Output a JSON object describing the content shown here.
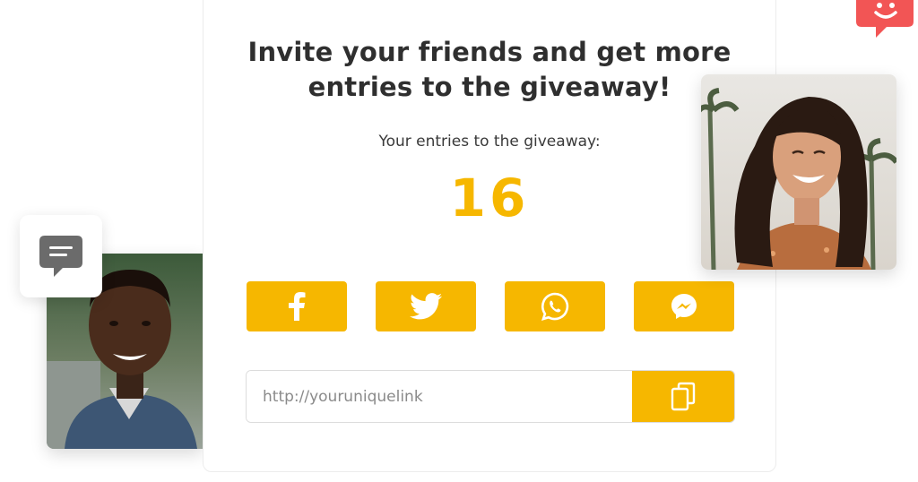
{
  "card": {
    "title_line1": "Invite your friends and get more",
    "title_line2": "entries to the giveaway!",
    "entries_label": "Your entries to the giveaway:",
    "entries_count": "16"
  },
  "share": {
    "buttons": [
      {
        "icon": "facebook-icon"
      },
      {
        "icon": "twitter-icon"
      },
      {
        "icon": "whatsapp-icon"
      },
      {
        "icon": "messenger-icon"
      }
    ]
  },
  "link": {
    "value": "http://youruniquelink",
    "copy_icon": "copy-icon"
  },
  "decor": {
    "chat_icon": "chat-bubble-icon",
    "badge_icon": "smiley-icon"
  },
  "colors": {
    "accent": "#f6b700",
    "badge": "#f25555",
    "chat_icon": "#6b6b6b"
  }
}
